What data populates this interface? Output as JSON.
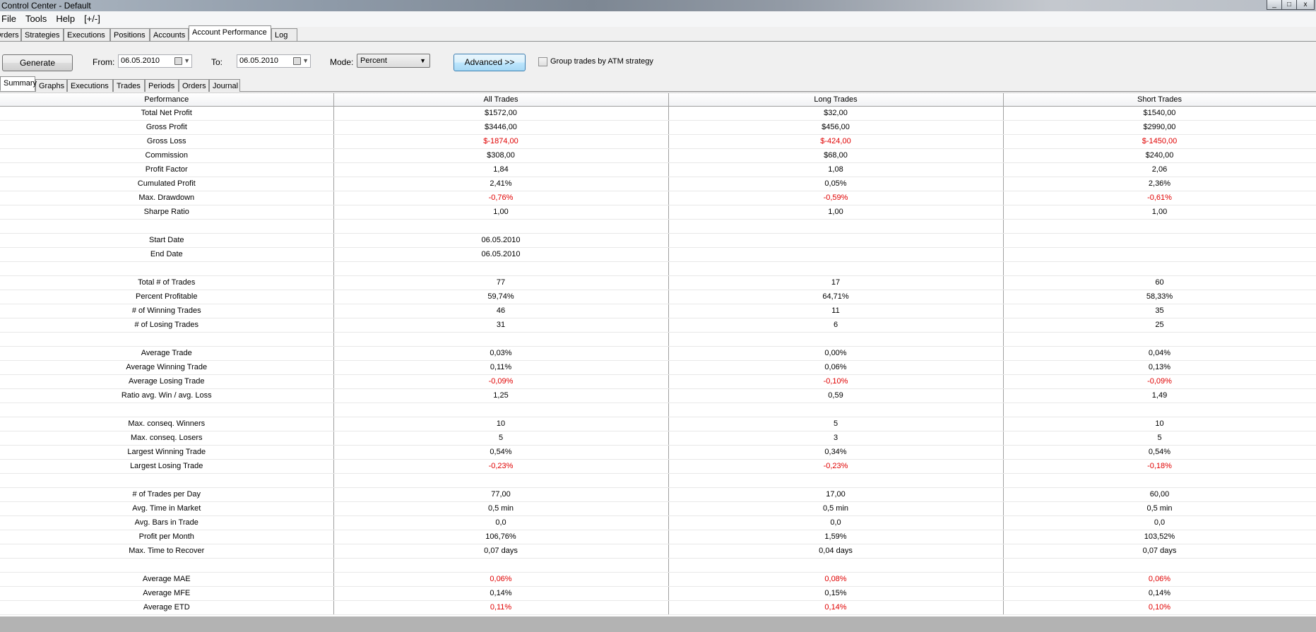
{
  "window": {
    "title": "Control Center - Default",
    "min_glyph": "_",
    "max_glyph": "□",
    "close_glyph": "x"
  },
  "menu": [
    "File",
    "Tools",
    "Help",
    "[+/-]"
  ],
  "main_tabs": [
    {
      "label": "Orders",
      "active": false
    },
    {
      "label": "Strategies",
      "active": false
    },
    {
      "label": "Executions",
      "active": false
    },
    {
      "label": "Positions",
      "active": false
    },
    {
      "label": "Accounts",
      "active": false
    },
    {
      "label": "Account Performance",
      "active": true
    },
    {
      "label": "Log",
      "active": false
    }
  ],
  "toolbar": {
    "generate_label": "Generate",
    "from_label": "From:",
    "from_value": "06.05.2010",
    "to_label": "To:",
    "to_value": "06.05.2010",
    "mode_label": "Mode:",
    "mode_value": "Percent",
    "advanced_label": "Advanced >>",
    "group_label": "Group trades by ATM strategy"
  },
  "sub_tabs": [
    {
      "label": "Summary",
      "active": true
    },
    {
      "label": "Graphs",
      "active": false
    },
    {
      "label": "Executions",
      "active": false
    },
    {
      "label": "Trades",
      "active": false
    },
    {
      "label": "Periods",
      "active": false
    },
    {
      "label": "Orders",
      "active": false
    },
    {
      "label": "Journal",
      "active": false
    }
  ],
  "colors": {
    "negative": "#e00000",
    "grid_border": "#a0a0a0"
  },
  "table": {
    "headers": [
      "Performance",
      "All Trades",
      "Long Trades",
      "Short Trades"
    ],
    "rows": [
      {
        "label": "Total Net Profit",
        "all": "$1572,00",
        "long": "$32,00",
        "short": "$1540,00",
        "negative": false
      },
      {
        "label": "Gross Profit",
        "all": "$3446,00",
        "long": "$456,00",
        "short": "$2990,00",
        "negative": false
      },
      {
        "label": "Gross Loss",
        "all": "$-1874,00",
        "long": "$-424,00",
        "short": "$-1450,00",
        "negative": true
      },
      {
        "label": "Commission",
        "all": "$308,00",
        "long": "$68,00",
        "short": "$240,00",
        "negative": false
      },
      {
        "label": "Profit Factor",
        "all": "1,84",
        "long": "1,08",
        "short": "2,06",
        "negative": false
      },
      {
        "label": "Cumulated Profit",
        "all": "2,41%",
        "long": "0,05%",
        "short": "2,36%",
        "negative": false
      },
      {
        "label": "Max. Drawdown",
        "all": "-0,76%",
        "long": "-0,59%",
        "short": "-0,61%",
        "negative": true
      },
      {
        "label": "Sharpe Ratio",
        "all": "1,00",
        "long": "1,00",
        "short": "1,00",
        "negative": false
      },
      {
        "label": "",
        "all": "",
        "long": "",
        "short": "",
        "negative": false
      },
      {
        "label": "Start Date",
        "all": "06.05.2010",
        "long": "",
        "short": "",
        "negative": false
      },
      {
        "label": "End Date",
        "all": "06.05.2010",
        "long": "",
        "short": "",
        "negative": false
      },
      {
        "label": "",
        "all": "",
        "long": "",
        "short": "",
        "negative": false
      },
      {
        "label": "Total # of Trades",
        "all": "77",
        "long": "17",
        "short": "60",
        "negative": false
      },
      {
        "label": "Percent Profitable",
        "all": "59,74%",
        "long": "64,71%",
        "short": "58,33%",
        "negative": false
      },
      {
        "label": "# of Winning Trades",
        "all": "46",
        "long": "11",
        "short": "35",
        "negative": false
      },
      {
        "label": "# of Losing Trades",
        "all": "31",
        "long": "6",
        "short": "25",
        "negative": false
      },
      {
        "label": "",
        "all": "",
        "long": "",
        "short": "",
        "negative": false
      },
      {
        "label": "Average Trade",
        "all": "0,03%",
        "long": "0,00%",
        "short": "0,04%",
        "negative": false
      },
      {
        "label": "Average Winning Trade",
        "all": "0,11%",
        "long": "0,06%",
        "short": "0,13%",
        "negative": false
      },
      {
        "label": "Average Losing Trade",
        "all": "-0,09%",
        "long": "-0,10%",
        "short": "-0,09%",
        "negative": true
      },
      {
        "label": "Ratio avg. Win / avg. Loss",
        "all": "1,25",
        "long": "0,59",
        "short": "1,49",
        "negative": false
      },
      {
        "label": "",
        "all": "",
        "long": "",
        "short": "",
        "negative": false
      },
      {
        "label": "Max. conseq. Winners",
        "all": "10",
        "long": "5",
        "short": "10",
        "negative": false
      },
      {
        "label": "Max. conseq. Losers",
        "all": "5",
        "long": "3",
        "short": "5",
        "negative": false
      },
      {
        "label": "Largest Winning Trade",
        "all": "0,54%",
        "long": "0,34%",
        "short": "0,54%",
        "negative": false
      },
      {
        "label": "Largest Losing Trade",
        "all": "-0,23%",
        "long": "-0,23%",
        "short": "-0,18%",
        "negative": true
      },
      {
        "label": "",
        "all": "",
        "long": "",
        "short": "",
        "negative": false
      },
      {
        "label": "# of Trades per Day",
        "all": "77,00",
        "long": "17,00",
        "short": "60,00",
        "negative": false
      },
      {
        "label": "Avg. Time in Market",
        "all": "0,5 min",
        "long": "0,5 min",
        "short": "0,5 min",
        "negative": false
      },
      {
        "label": "Avg. Bars in Trade",
        "all": "0,0",
        "long": "0,0",
        "short": "0,0",
        "negative": false
      },
      {
        "label": "Profit per Month",
        "all": "106,76%",
        "long": "1,59%",
        "short": "103,52%",
        "negative": false
      },
      {
        "label": "Max. Time to Recover",
        "all": "0,07 days",
        "long": "0,04 days",
        "short": "0,07 days",
        "negative": false
      },
      {
        "label": "",
        "all": "",
        "long": "",
        "short": "",
        "negative": false
      },
      {
        "label": "Average MAE",
        "all": "0,06%",
        "long": "0,08%",
        "short": "0,06%",
        "negative": true
      },
      {
        "label": "Average MFE",
        "all": "0,14%",
        "long": "0,15%",
        "short": "0,14%",
        "negative": false
      },
      {
        "label": "Average ETD",
        "all": "0,11%",
        "long": "0,14%",
        "short": "0,10%",
        "negative": true
      }
    ]
  }
}
